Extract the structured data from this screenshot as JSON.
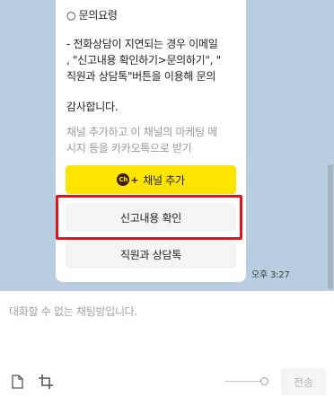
{
  "message": {
    "section_header": "○ 문의요령",
    "line_a": "- 전화상담이 지연되는 경우 이메일",
    "line_b": ", \"신고내용 확인하기>문의하기\", \"",
    "line_c": "직원과 상담톡\"버튼을 이용해 문의",
    "thanks": "감사합니다.",
    "notice_a": "채널 추가하고 이 채널의 마케팅 메",
    "notice_b": "시지 등을 카카오톡으로 받기"
  },
  "buttons": {
    "add_channel_icon": "Ch",
    "add_channel_plus": "+",
    "add_channel": "채널 추가",
    "check_report": "신고내용 확인",
    "talk_agent": "직원과 상담톡"
  },
  "timestamp": "오후 3:27",
  "input": {
    "placeholder": "대화할 수 없는 채팅방입니다."
  },
  "toolbar": {
    "send_label": "전송",
    "file_icon": "file-icon",
    "crop_icon": "crop-icon"
  },
  "colors": {
    "chat_background": "#b9cde0",
    "channel_button": "#fee500",
    "highlight": "#e0161e"
  }
}
